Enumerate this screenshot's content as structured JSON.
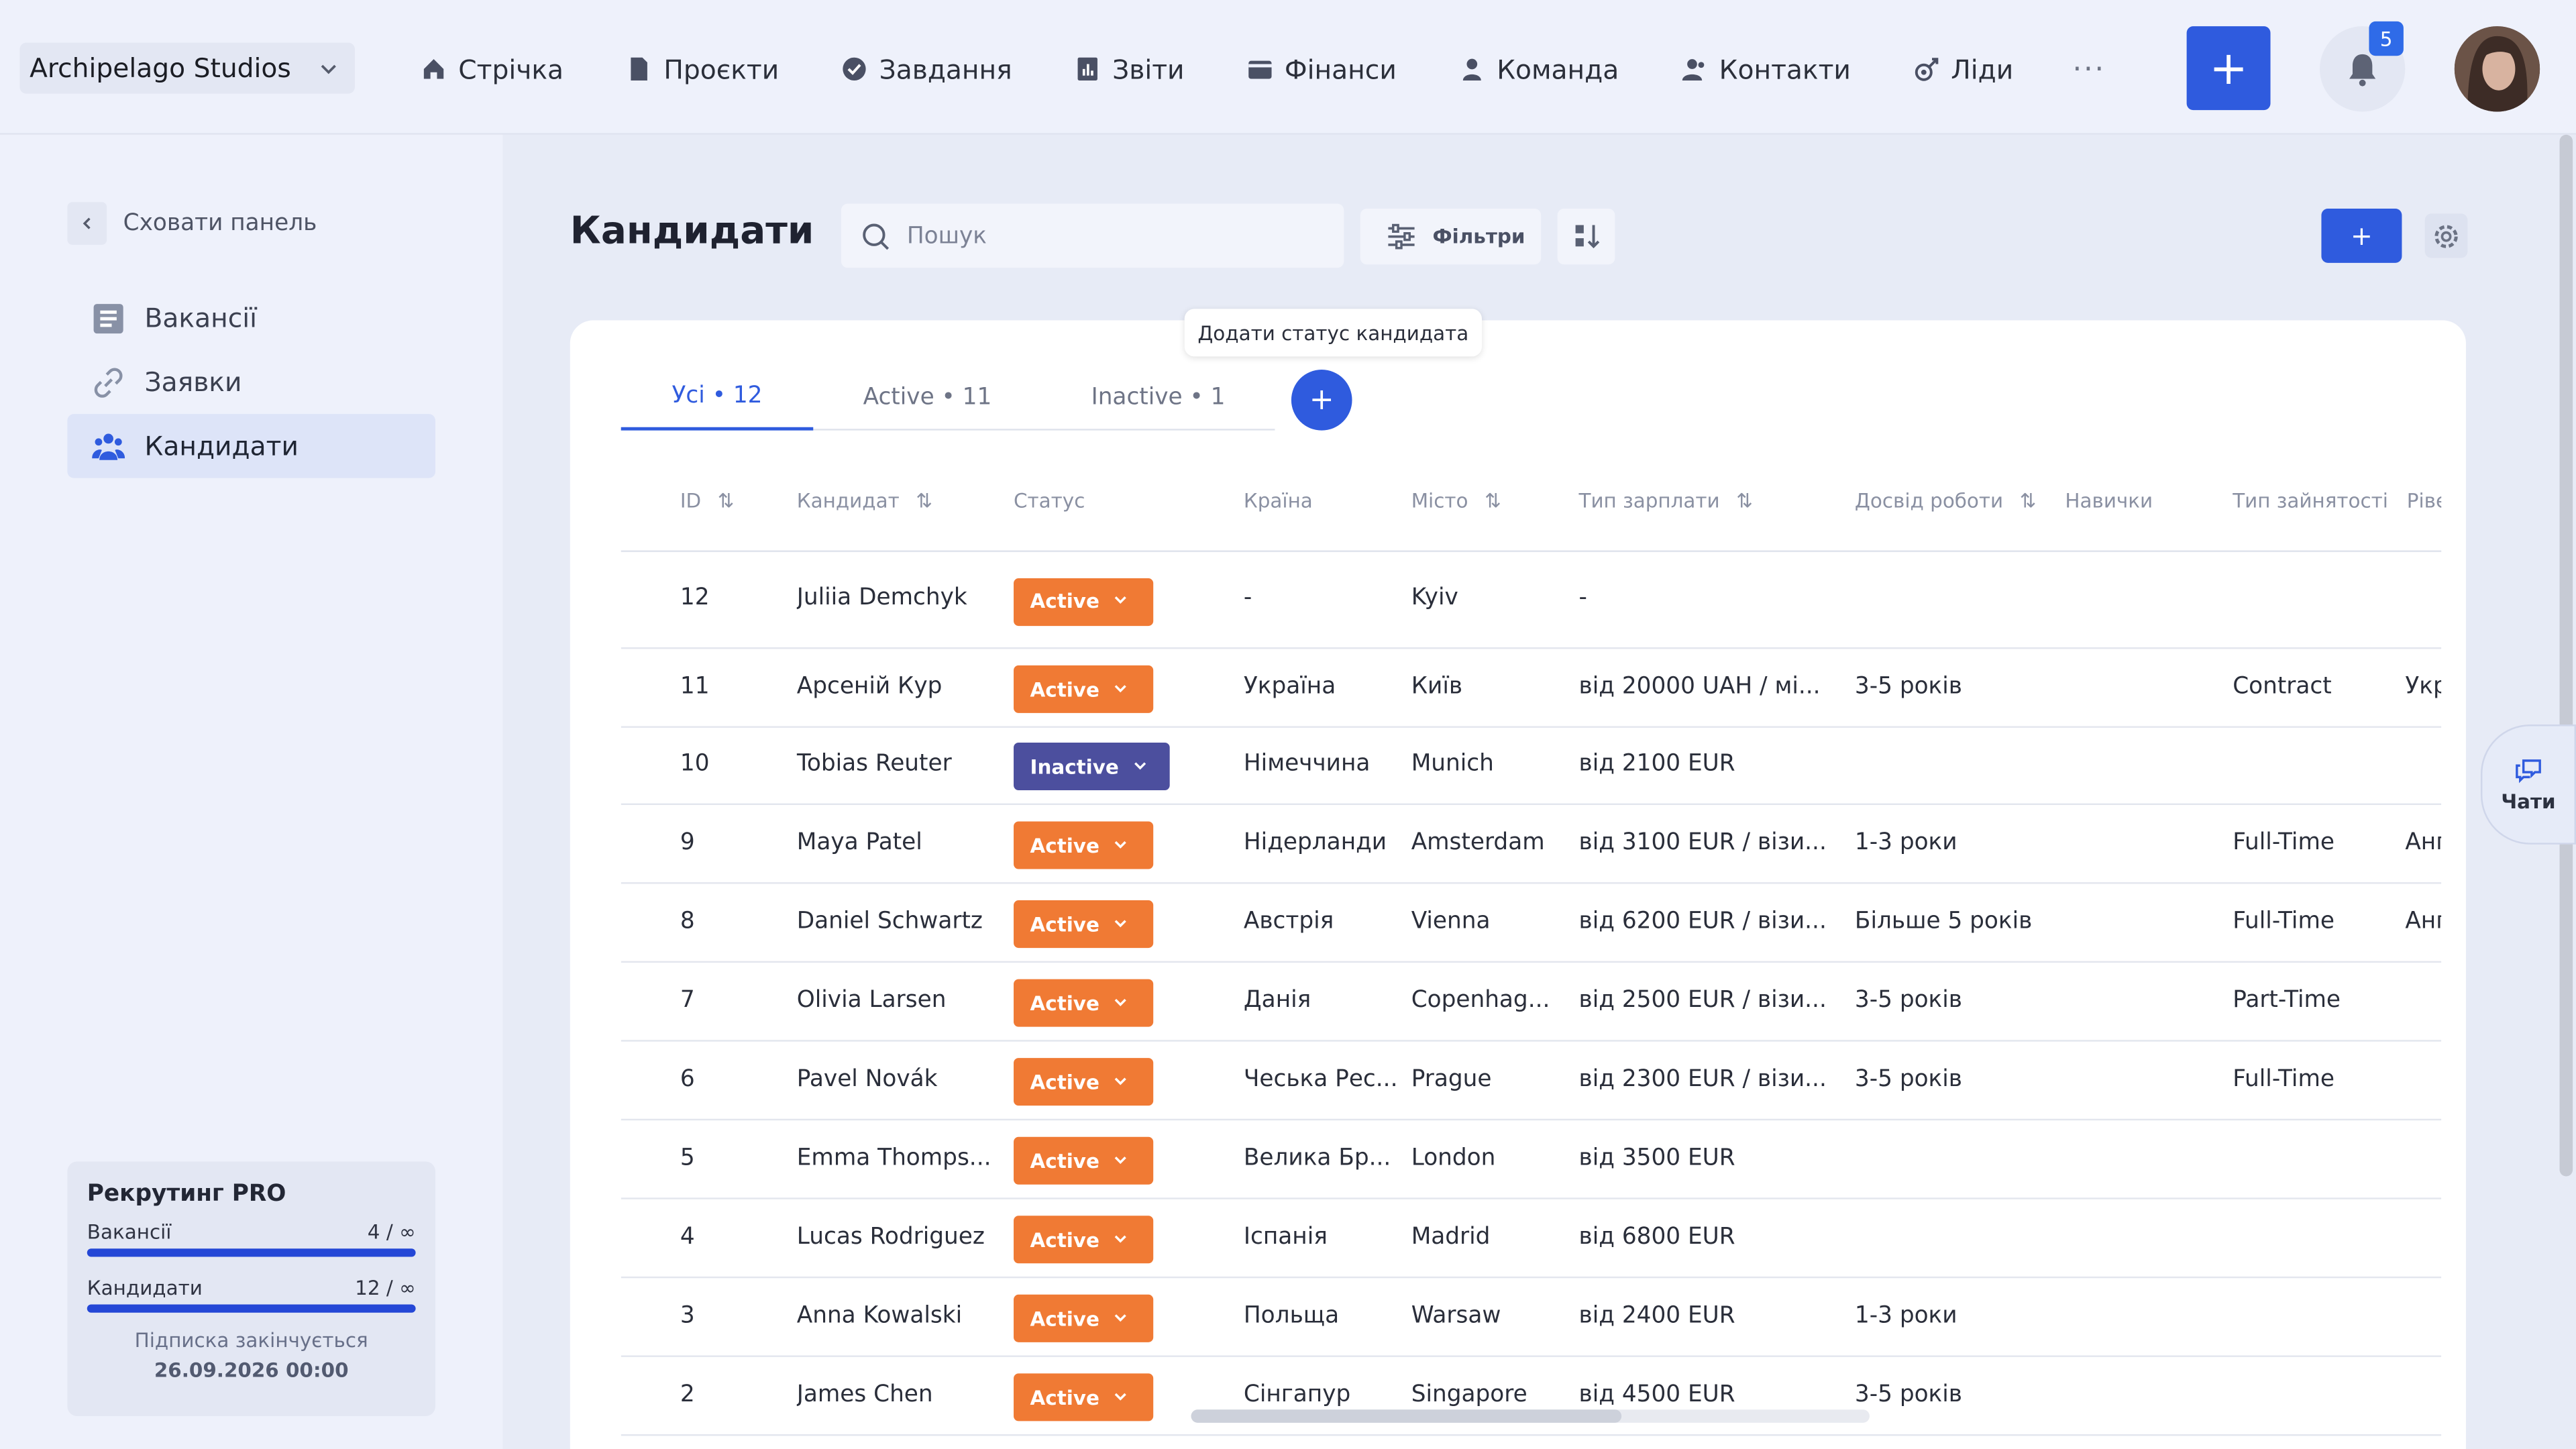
{
  "company": {
    "name": "Archipelago Studios"
  },
  "nav": [
    {
      "label": "Стрічка",
      "icon": "home-icon"
    },
    {
      "label": "Проєкти",
      "icon": "document-icon"
    },
    {
      "label": "Завдання",
      "icon": "check-circle-icon"
    },
    {
      "label": "Звіти",
      "icon": "chart-icon"
    },
    {
      "label": "Фінанси",
      "icon": "wallet-icon"
    },
    {
      "label": "Команда",
      "icon": "person-icon"
    },
    {
      "label": "Контакти",
      "icon": "contacts-icon"
    },
    {
      "label": "Ліди",
      "icon": "leads-icon"
    }
  ],
  "more_label": "···",
  "header": {
    "plus": "+",
    "notifications_count": "5"
  },
  "sidebar": {
    "hide_label": "Сховати панель",
    "items": [
      {
        "label": "Вакансії",
        "icon": "list-icon"
      },
      {
        "label": "Заявки",
        "icon": "link-icon"
      },
      {
        "label": "Кандидати",
        "icon": "people-icon"
      }
    ],
    "plan": {
      "title": "Рекрутинг PRO",
      "vacancies_label": "Вакансії",
      "vacancies_value": "4 / ∞",
      "candidates_label": "Кандидати",
      "candidates_value": "12 / ∞",
      "note": "Підписка закінчується",
      "date": "26.09.2026 00:00"
    }
  },
  "page": {
    "title": "Кандидати",
    "search_placeholder": "Пошук",
    "filters_label": "Фільтри",
    "add_label": "+",
    "tooltip": "Додати статус кандидата"
  },
  "tabs": [
    {
      "label": "Усі • 12"
    },
    {
      "label": "Active • 11"
    },
    {
      "label": "Inactive • 1"
    }
  ],
  "tab_add": "+",
  "columns": [
    "ID",
    "Кандидат",
    "Статус",
    "Країна",
    "Місто",
    "Тип зарплати",
    "Досвід роботи",
    "Навички",
    "Тип зайнятості",
    "Рівень"
  ],
  "rows": [
    {
      "id": "12",
      "name": "Juliia Demchyk",
      "status": "Active",
      "country": "-",
      "city": "Kyiv",
      "salary": "-",
      "experience": "",
      "employment": "",
      "level": ""
    },
    {
      "id": "11",
      "name": "Арсеній Кур",
      "status": "Active",
      "country": "Україна",
      "city": "Київ",
      "salary": "від 20000 UAH / мі...",
      "experience": "3-5 років",
      "employment": "Contract",
      "level": "Укр"
    },
    {
      "id": "10",
      "name": "Tobias Reuter",
      "status": "Inactive",
      "country": "Німеччина",
      "city": "Munich",
      "salary": "від 2100 EUR",
      "experience": "",
      "employment": "",
      "level": ""
    },
    {
      "id": "9",
      "name": "Maya Patel",
      "status": "Active",
      "country": "Нідерланди",
      "city": "Amsterdam",
      "salary": "від 3100 EUR / візи...",
      "experience": "1-3 роки",
      "employment": "Full-Time",
      "level": "Анг"
    },
    {
      "id": "8",
      "name": "Daniel Schwartz",
      "status": "Active",
      "country": "Австрія",
      "city": "Vienna",
      "salary": "від 6200 EUR / візи...",
      "experience": "Більше 5 років",
      "employment": "Full-Time",
      "level": "Анг"
    },
    {
      "id": "7",
      "name": "Olivia Larsen",
      "status": "Active",
      "country": "Данія",
      "city": "Copenhag...",
      "salary": "від 2500 EUR / візи...",
      "experience": "3-5 років",
      "employment": "Part-Time",
      "level": ""
    },
    {
      "id": "6",
      "name": "Pavel Novák",
      "status": "Active",
      "country": "Чеська Рес...",
      "city": "Prague",
      "salary": "від 2300 EUR / візи...",
      "experience": "3-5 років",
      "employment": "Full-Time",
      "level": ""
    },
    {
      "id": "5",
      "name": "Emma Thomps...",
      "status": "Active",
      "country": "Велика Бр...",
      "city": "London",
      "salary": "від 3500 EUR",
      "experience": "",
      "employment": "",
      "level": ""
    },
    {
      "id": "4",
      "name": "Lucas Rodriguez",
      "status": "Active",
      "country": "Іспанія",
      "city": "Madrid",
      "salary": "від 6800 EUR",
      "experience": "",
      "employment": "",
      "level": ""
    },
    {
      "id": "3",
      "name": "Anna Kowalski",
      "status": "Active",
      "country": "Польща",
      "city": "Warsaw",
      "salary": "від 2400 EUR",
      "experience": "1-3 роки",
      "employment": "",
      "level": ""
    },
    {
      "id": "2",
      "name": "James Chen",
      "status": "Active",
      "country": "Сінгапур",
      "city": "Singapore",
      "salary": "від 4500 EUR",
      "experience": "3-5 років",
      "employment": "",
      "level": ""
    }
  ],
  "chats_label": "Чати",
  "colors": {
    "accent": "#2f5bde",
    "active_status": "#f07a34",
    "inactive_status": "#4c4f9e"
  }
}
